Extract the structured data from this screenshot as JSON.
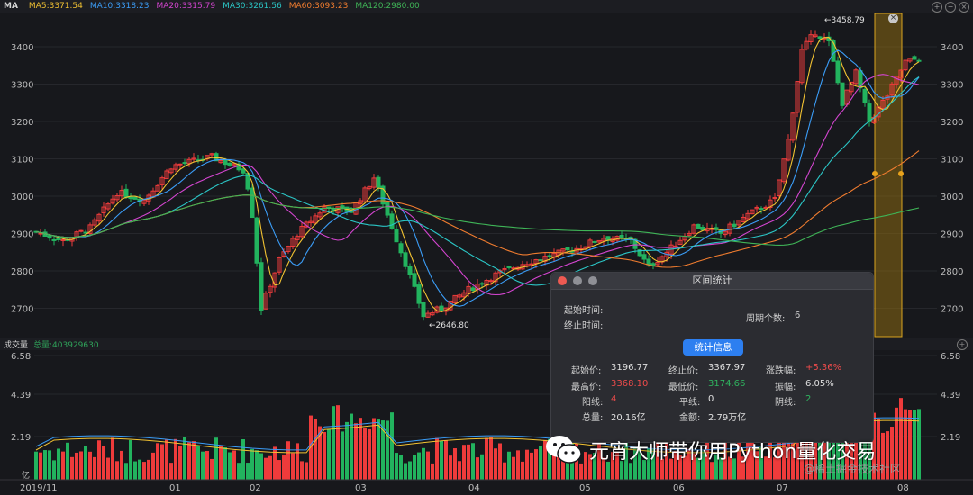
{
  "ma_header": {
    "title": "MA",
    "items": [
      {
        "label": "MA5:3371.54",
        "color": "#f2c232"
      },
      {
        "label": "MA10:3318.23",
        "color": "#3b9df7"
      },
      {
        "label": "MA20:3315.79",
        "color": "#d445d0"
      },
      {
        "label": "MA30:3261.56",
        "color": "#2bc6c6"
      },
      {
        "label": "MA60:3093.23",
        "color": "#f07c2f"
      },
      {
        "label": "MA120:2980.00",
        "color": "#3fb457"
      }
    ],
    "buttons": [
      "+",
      "−",
      "×"
    ]
  },
  "price_axis": {
    "ticks": [
      "3400",
      "3300",
      "3200",
      "3100",
      "3000",
      "2900",
      "2800",
      "2700"
    ]
  },
  "price_annotations": {
    "high": "←3458.79",
    "low": "←2646.80"
  },
  "volume_header": {
    "title": "成交量",
    "total": "总量:403929630"
  },
  "volume_axis": {
    "ticks": [
      "6.58",
      "4.39",
      "2.19"
    ],
    "unit": "亿"
  },
  "x_axis": {
    "labels": [
      "2019/11",
      "01",
      "02",
      "03",
      "04",
      "05",
      "06",
      "07",
      "08"
    ]
  },
  "dialog": {
    "title": "区间统计",
    "start_time_label": "起始时间:",
    "end_time_label": "终止时间:",
    "period_label": "周期个数:",
    "period_value": "6",
    "button_label": "统计信息",
    "stats": {
      "start_price_label": "起始价:",
      "start_price": "3196.77",
      "end_price_label": "终止价:",
      "end_price": "3367.97",
      "change_label": "涨跌幅:",
      "change": "+5.36%",
      "high_label": "最高价:",
      "high": "3368.10",
      "low_label": "最低价:",
      "low": "3174.66",
      "amplitude_label": "振幅:",
      "amplitude": "6.05%",
      "up_label": "阳线:",
      "up": "4",
      "flat_label": "平线:",
      "flat": "0",
      "down_label": "阴线:",
      "down": "2",
      "volume_label": "总量:",
      "volume": "20.16亿",
      "amount_label": "金额:",
      "amount": "2.79万亿"
    }
  },
  "watermark": {
    "text": "元宵大师带你用Python量化交易",
    "small": "@稀土掘金技术社区"
  },
  "colors": {
    "up": "#ee3b3b",
    "down": "#22b35e",
    "background": "#17181c",
    "highlight": "#b8860b"
  }
}
